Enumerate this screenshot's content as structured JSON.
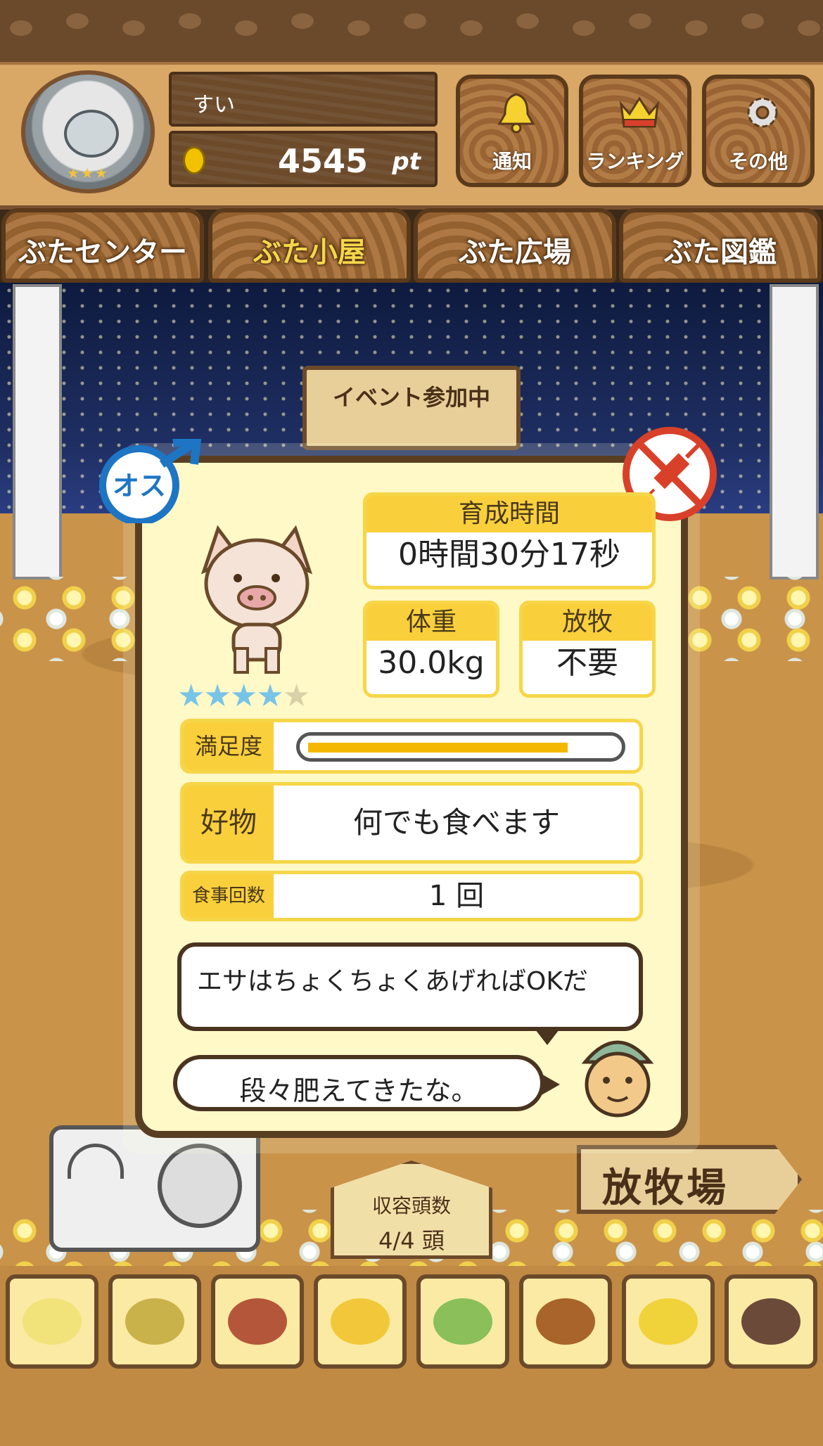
{
  "header": {
    "player_name": "すい",
    "points": "4545",
    "points_unit": "pt",
    "buttons": [
      {
        "label": "通知",
        "icon": "bell-icon"
      },
      {
        "label": "ランキング",
        "icon": "crown-icon"
      },
      {
        "label": "その他",
        "icon": "gear-icon"
      }
    ]
  },
  "nav": {
    "tabs": [
      {
        "label": "ぶたセンター",
        "active": false
      },
      {
        "label": "ぶた小屋",
        "active": true
      },
      {
        "label": "ぶた広場",
        "active": false
      },
      {
        "label": "ぶた図鑑",
        "active": false
      }
    ]
  },
  "scene": {
    "event_sign": "イベント参加中",
    "capacity_label": "収容頭数",
    "capacity_value": "4/4 頭",
    "pasture_sign": "放牧場"
  },
  "pig": {
    "sex_badge": "オス",
    "rating": 4,
    "rating_max": 5,
    "growth_time_label": "育成時間",
    "growth_time": "0時間30分17秒",
    "weight_label": "体重",
    "weight": "30.0kg",
    "grazing_label": "放牧",
    "grazing": "不要",
    "satisfaction_label": "満足度",
    "satisfaction_level": 0.83,
    "favorite_label": "好物",
    "favorite": "何でも食べます",
    "meals_label": "食事回数",
    "meals": "1 回",
    "advice": "エサはちょくちょくあげればOKだ",
    "comment": "段々肥えてきたな。"
  },
  "food_bar": {
    "items": [
      "grain-pile-icon",
      "mixed-grain-icon",
      "sweet-potato-icon",
      "corn-icon",
      "vegetables-icon",
      "acorn-icon",
      "bean-plate-icon",
      "meatball-plate-icon"
    ]
  },
  "colors": {
    "accent_yellow": "#f9d03c",
    "wood_dark": "#5a3e22",
    "card_bg": "#fff9c8",
    "male_blue": "#1d75c4",
    "no_injection_red": "#d9402a"
  }
}
